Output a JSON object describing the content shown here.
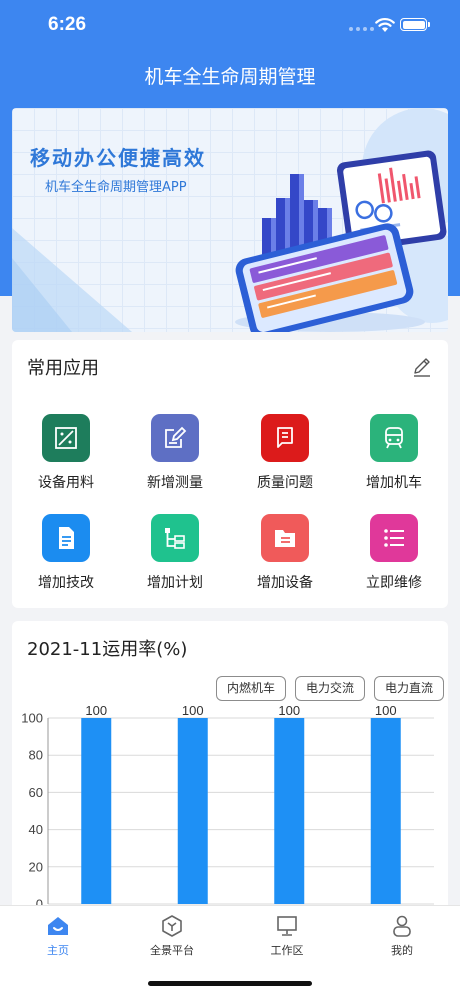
{
  "status": {
    "time": "6:26"
  },
  "app": {
    "title": "机车全生命周期管理"
  },
  "banner": {
    "headline": "移动办公便捷高效",
    "subtitle": "机车全生命周期管理APP"
  },
  "apps": {
    "title": "常用应用",
    "edit_icon": "pencil-icon",
    "items": [
      {
        "label": "设备用料",
        "color": "#1e7d5c",
        "icon": "material-icon"
      },
      {
        "label": "新增测量",
        "color": "#5e6fc4",
        "icon": "measure-edit-icon"
      },
      {
        "label": "质量问题",
        "color": "#dc1b1b",
        "icon": "quality-doc-icon"
      },
      {
        "label": "增加机车",
        "color": "#2bb37b",
        "icon": "locomotive-icon"
      },
      {
        "label": "增加技改",
        "color": "#1b8cf0",
        "icon": "document-icon"
      },
      {
        "label": "增加计划",
        "color": "#1fc28e",
        "icon": "plan-tree-icon"
      },
      {
        "label": "增加设备",
        "color": "#f05a5a",
        "icon": "folder-list-icon"
      },
      {
        "label": "立即维修",
        "color": "#e0389a",
        "icon": "list-icon"
      }
    ]
  },
  "chart": {
    "title": "2021-11运用率(%)",
    "legend": [
      "内燃机车",
      "电力交流",
      "电力直流"
    ]
  },
  "chart_data": {
    "type": "bar",
    "title": "2021-11运用率(%)",
    "categories": [
      "",
      "",
      "",
      ""
    ],
    "values": [
      100,
      100,
      100,
      100
    ],
    "data_labels": [
      "100",
      "100",
      "100",
      "100"
    ],
    "y_ticks": [
      "100",
      "80",
      "60",
      "40",
      "20",
      "0"
    ],
    "ylim": [
      0,
      100
    ],
    "bar_color": "#1e90f5",
    "grid": true
  },
  "tabbar": {
    "items": [
      {
        "label": "主页",
        "icon": "home-icon",
        "active": true
      },
      {
        "label": "全景平台",
        "icon": "cube-icon",
        "active": false
      },
      {
        "label": "工作区",
        "icon": "monitor-icon",
        "active": false
      },
      {
        "label": "我的",
        "icon": "user-icon",
        "active": false
      }
    ]
  }
}
